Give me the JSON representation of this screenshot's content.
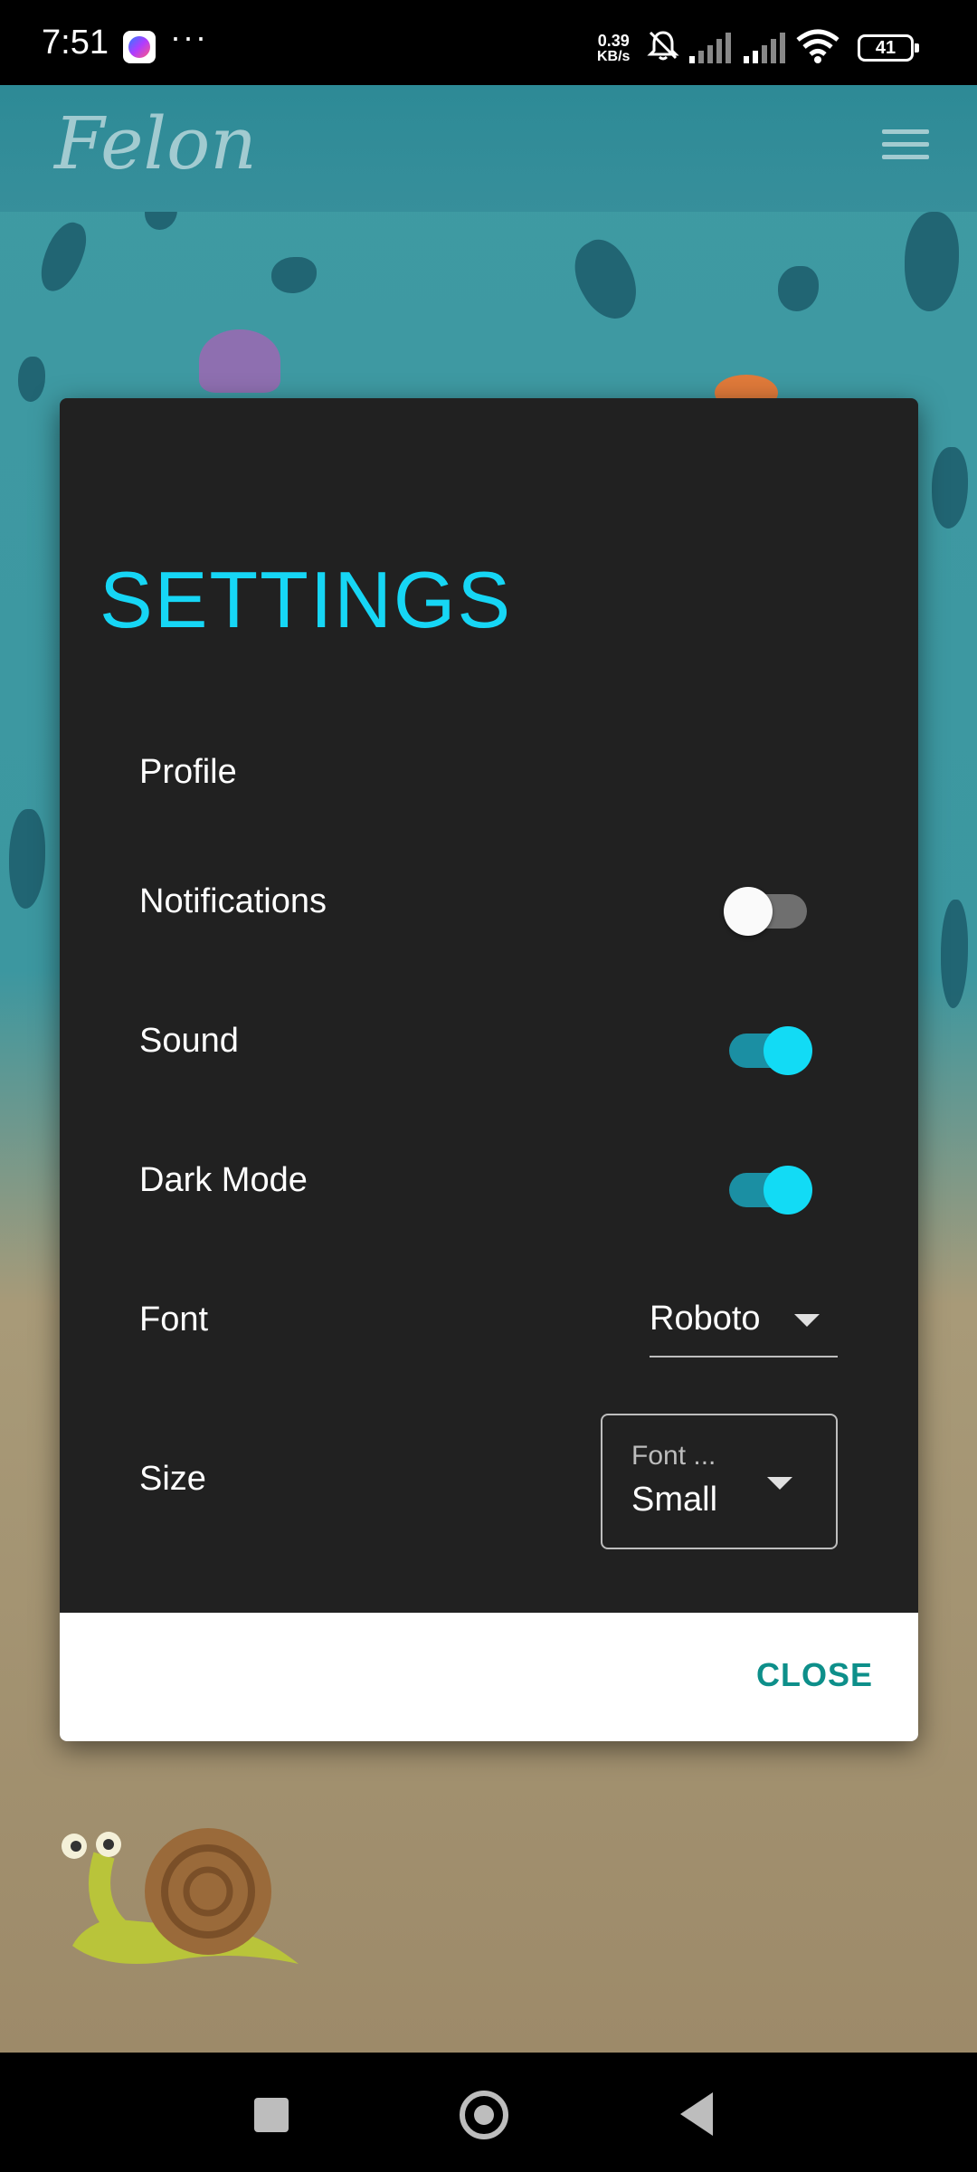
{
  "status_bar": {
    "time": "7:51",
    "dots": "···",
    "net_speed_value": "0.39",
    "net_speed_unit": "KB/s",
    "battery": "41"
  },
  "app": {
    "logo": "Felon"
  },
  "dialog": {
    "title": "SETTINGS",
    "items": [
      {
        "label": "Profile"
      },
      {
        "label": "Notifications",
        "toggle": false
      },
      {
        "label": "Sound",
        "toggle": true
      },
      {
        "label": "Dark Mode",
        "toggle": true
      },
      {
        "label": "Font",
        "select_value": "Roboto"
      },
      {
        "label": "Size",
        "select_label": "Font ...",
        "select_value": "Small"
      }
    ],
    "close_label": "CLOSE"
  },
  "colors": {
    "accent": "#16d6f5",
    "close": "#0d8f8a",
    "dialog_bg": "#212121"
  }
}
